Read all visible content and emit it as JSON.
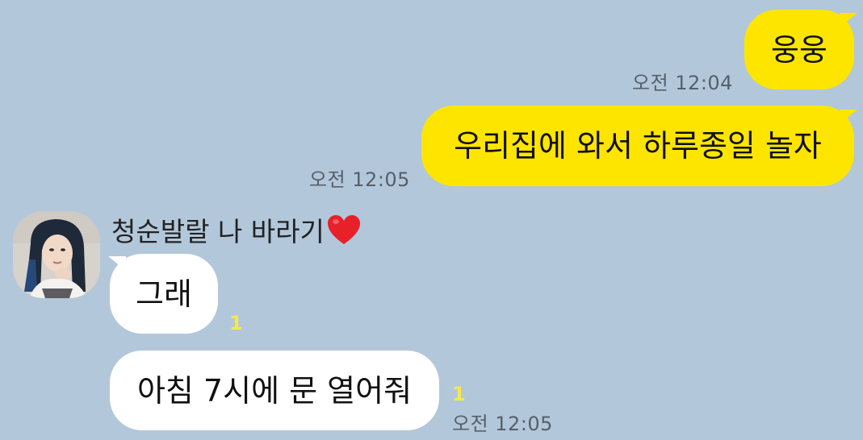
{
  "messages": [
    {
      "id": "m1",
      "side": "mine",
      "text": "웅웅",
      "time": "오전 12:04"
    },
    {
      "id": "m2",
      "side": "mine",
      "text": "우리집에 와서 하루종일 놀자",
      "time": "오전 12:05"
    },
    {
      "id": "m3",
      "side": "theirs",
      "text": "그래",
      "unread": "1"
    },
    {
      "id": "m4",
      "side": "theirs",
      "text": "아침 7시에 문 열어줘",
      "unread": "1",
      "time": "오전 12:05"
    }
  ],
  "sender": {
    "name": "청순발랄 나 바라기",
    "avatar_icon": "profile-photo",
    "name_icon": "heart-icon"
  },
  "colors": {
    "background": "#b2c7da",
    "my_bubble": "#fee500",
    "their_bubble": "#ffffff",
    "unread": "#f6e84a",
    "heart": "#e8202a"
  }
}
